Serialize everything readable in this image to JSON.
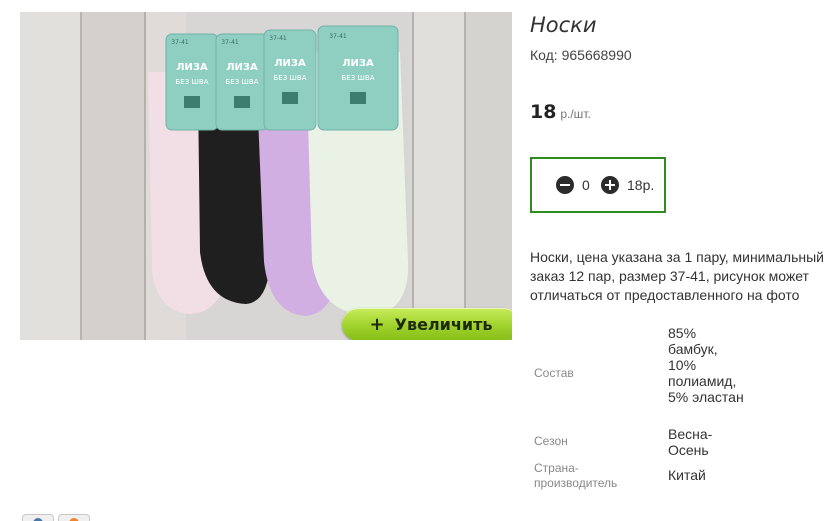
{
  "product": {
    "title": "Носки",
    "code_label": "Код: 965668990",
    "price_value": "18",
    "price_unit": "р./шт.",
    "zoom_button_label": "Увеличить",
    "zoom_button_icon": "+",
    "description": "Носки, цена указана за 1 пару, минимальный заказ 12 пар, размер 37-41, рисунок может отличаться от предоставленного на фото",
    "photo_text": {
      "brand": "ЛИЗА",
      "seamless": "БЕЗ ШВА",
      "size": "37-41"
    }
  },
  "quantity": {
    "value": "0",
    "sum": "18р."
  },
  "specs": {
    "composition_label": "Состав",
    "composition_value": "85% бамбук, 10% полиамид, 5% эластан",
    "season_label": "Сезон",
    "season_value": "Весна-Осень",
    "country_label": "Страна-производитель",
    "country_value": "Китай"
  },
  "colors": {
    "accent_green": "#2e8b1e",
    "button_green": "#9ed12b",
    "label_mint": "#8fcfc2"
  },
  "icons": {
    "minus": "minus-circle-icon",
    "plus": "plus-circle-icon",
    "vk": "vk-icon",
    "ok": "odnoklassniki-icon"
  }
}
